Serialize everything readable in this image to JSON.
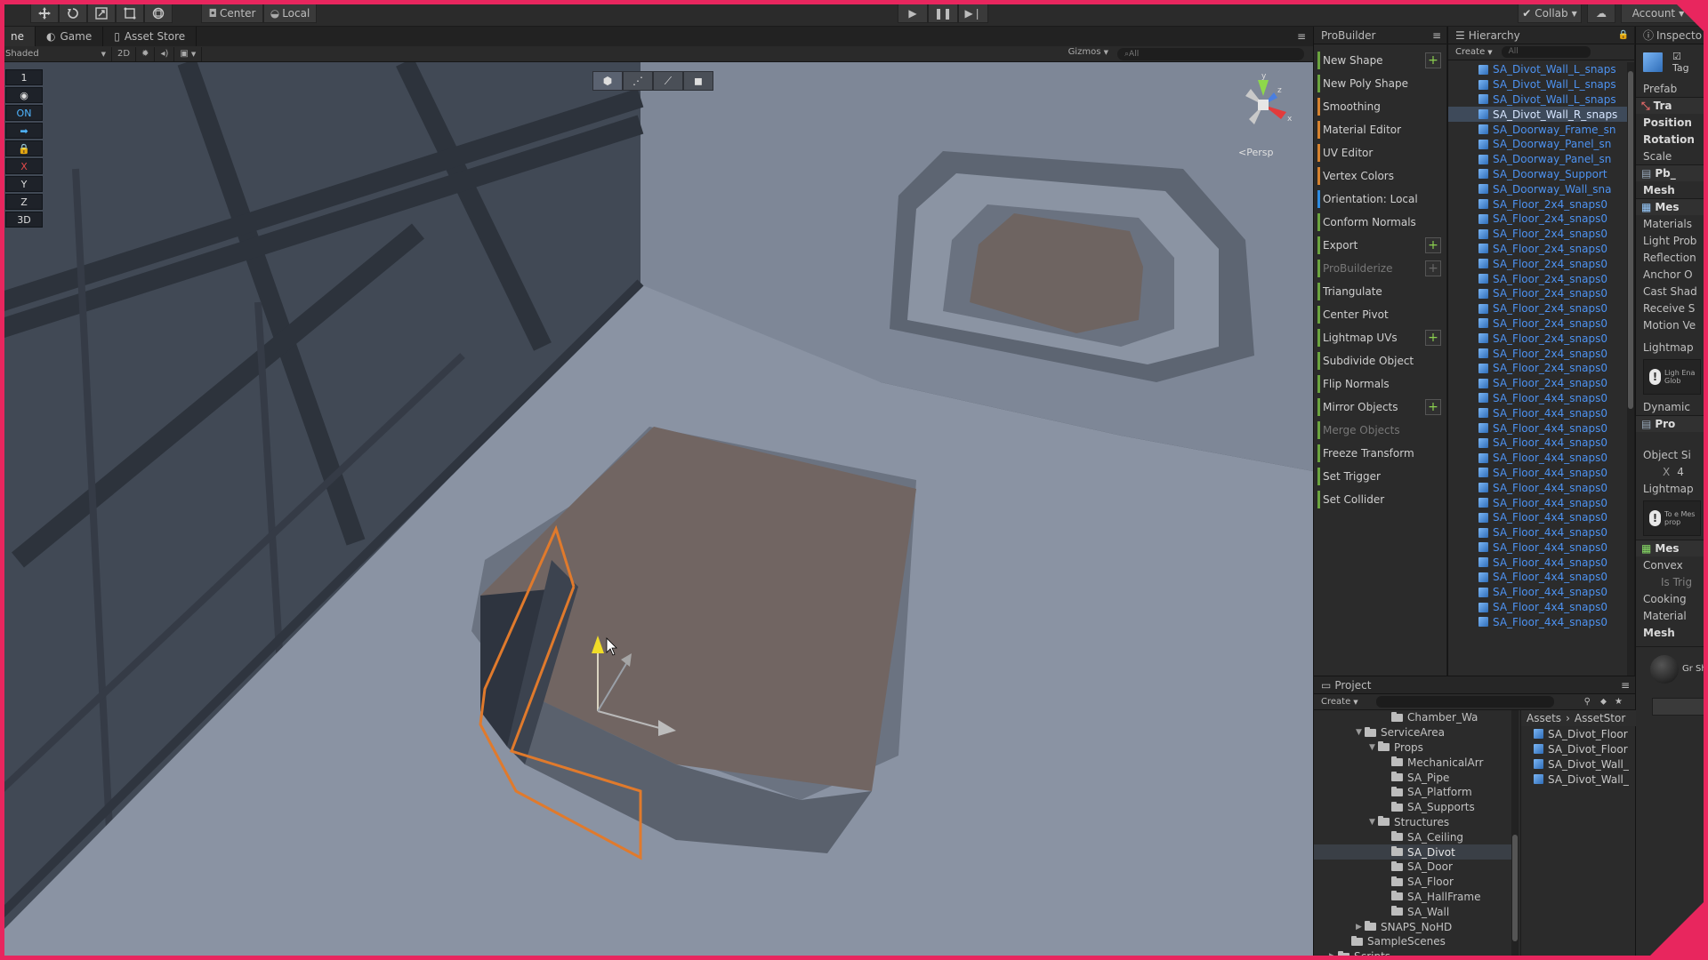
{
  "toolbar": {
    "pivot_mode": "Center",
    "pivot_rotation": "Local",
    "collab": "Collab",
    "account": "Account"
  },
  "scene_tabs": [
    {
      "label": "ne",
      "icon": "scene-icon"
    },
    {
      "label": "Game",
      "icon": "game-icon"
    },
    {
      "label": "Asset Store",
      "icon": "store-icon"
    }
  ],
  "scene_controls": {
    "draw_mode": "Shaded",
    "mode_2d": "2D",
    "gizmos": "Gizmos",
    "search_placeholder": "All"
  },
  "left_overlay": {
    "items": [
      "1",
      "",
      "ON",
      "",
      "",
      "X",
      "Y",
      "Z",
      "3D"
    ]
  },
  "scene": {
    "persp_label": "Persp",
    "axis_y": "y",
    "axis_x": "x",
    "axis_z": "z"
  },
  "probuilder": {
    "title": "ProBuilder",
    "items": [
      {
        "label": "New Shape",
        "color": "green",
        "plus": true,
        "enabled": true
      },
      {
        "label": "New Poly Shape",
        "color": "green",
        "plus": false,
        "enabled": true
      },
      {
        "label": "Smoothing",
        "color": "orange",
        "plus": false,
        "enabled": true
      },
      {
        "label": "Material Editor",
        "color": "orange",
        "plus": false,
        "enabled": true
      },
      {
        "label": "UV Editor",
        "color": "orange",
        "plus": false,
        "enabled": true
      },
      {
        "label": "Vertex Colors",
        "color": "orange",
        "plus": false,
        "enabled": true
      },
      {
        "label": "Orientation: Local",
        "color": "blue",
        "plus": false,
        "enabled": true
      },
      {
        "label": "Conform Normals",
        "color": "green",
        "plus": false,
        "enabled": true
      },
      {
        "label": "Export",
        "color": "green",
        "plus": true,
        "enabled": true
      },
      {
        "label": "ProBuilderize",
        "color": "green",
        "plus": true,
        "enabled": false
      },
      {
        "label": "Triangulate",
        "color": "green",
        "plus": false,
        "enabled": true
      },
      {
        "label": "Center Pivot",
        "color": "green",
        "plus": false,
        "enabled": true
      },
      {
        "label": "Lightmap UVs",
        "color": "green",
        "plus": true,
        "enabled": true
      },
      {
        "label": "Subdivide Object",
        "color": "green",
        "plus": false,
        "enabled": true
      },
      {
        "label": "Flip Normals",
        "color": "green",
        "plus": false,
        "enabled": true
      },
      {
        "label": "Mirror Objects",
        "color": "green",
        "plus": true,
        "enabled": true
      },
      {
        "label": "Merge Objects",
        "color": "green",
        "plus": false,
        "enabled": false
      },
      {
        "label": "Freeze Transform",
        "color": "green",
        "plus": false,
        "enabled": true
      },
      {
        "label": "Set Trigger",
        "color": "green",
        "plus": false,
        "enabled": true
      },
      {
        "label": "Set Collider",
        "color": "green",
        "plus": false,
        "enabled": true
      }
    ]
  },
  "hierarchy": {
    "title": "Hierarchy",
    "create": "Create",
    "search_placeholder": "All",
    "items": [
      "SA_Divot_Wall_L_snaps",
      "SA_Divot_Wall_L_snaps",
      "SA_Divot_Wall_L_snaps",
      "SA_Divot_Wall_R_snaps",
      "SA_Doorway_Frame_sn",
      "SA_Doorway_Panel_sn",
      "SA_Doorway_Panel_sn",
      "SA_Doorway_Support",
      "SA_Doorway_Wall_sna",
      "SA_Floor_2x4_snaps0",
      "SA_Floor_2x4_snaps0",
      "SA_Floor_2x4_snaps0",
      "SA_Floor_2x4_snaps0",
      "SA_Floor_2x4_snaps0",
      "SA_Floor_2x4_snaps0",
      "SA_Floor_2x4_snaps0",
      "SA_Floor_2x4_snaps0",
      "SA_Floor_2x4_snaps0",
      "SA_Floor_2x4_snaps0",
      "SA_Floor_2x4_snaps0",
      "SA_Floor_2x4_snaps0",
      "SA_Floor_2x4_snaps0",
      "SA_Floor_4x4_snaps0",
      "SA_Floor_4x4_snaps0",
      "SA_Floor_4x4_snaps0",
      "SA_Floor_4x4_snaps0",
      "SA_Floor_4x4_snaps0",
      "SA_Floor_4x4_snaps0",
      "SA_Floor_4x4_snaps0",
      "SA_Floor_4x4_snaps0",
      "SA_Floor_4x4_snaps0",
      "SA_Floor_4x4_snaps0",
      "SA_Floor_4x4_snaps0",
      "SA_Floor_4x4_snaps0",
      "SA_Floor_4x4_snaps0",
      "SA_Floor_4x4_snaps0",
      "SA_Floor_4x4_snaps0",
      "SA_Floor_4x4_snaps0"
    ],
    "selected_index": 3
  },
  "inspector": {
    "title": "Inspecto",
    "tag_label": "Tag",
    "prefab_label": "Prefab",
    "transform_header": "Tra",
    "position": "Position",
    "rotation": "Rotation",
    "scale": "Scale",
    "pb_header": "Pb_",
    "mesh_label": "Mesh",
    "mesh_renderer_header": "Mes",
    "materials": "Materials",
    "light_probes": "Light Prob",
    "reflection": "Reflection",
    "anchor": "Anchor O",
    "cast_shadows": "Cast Shad",
    "receive_shadows": "Receive S",
    "motion_vectors": "Motion Ve",
    "lightmap": "Lightmap",
    "lightmap_note": "Ligh Ena Glob",
    "dynamic": "Dynamic",
    "pro_header": "Pro",
    "object_size": "Object Si",
    "size_x_label": "X",
    "size_x_value": "4",
    "lightmap2": "Lightmap",
    "lightmap_note2": "To e Mes prop",
    "mesh_collider_header": "Mes",
    "convex": "Convex",
    "is_trigger": "Is Trig",
    "cooking": "Cooking",
    "material": "Material",
    "mesh2": "Mesh",
    "material_preview_label": "Gr Sh"
  },
  "project": {
    "title": "Project",
    "create": "Create",
    "tree": [
      {
        "label": "Chamber_Wa",
        "indent": 5,
        "arrow": "",
        "selected": false
      },
      {
        "label": "ServiceArea",
        "indent": 3,
        "arrow": "▼",
        "selected": false
      },
      {
        "label": "Props",
        "indent": 4,
        "arrow": "▼",
        "selected": false
      },
      {
        "label": "MechanicalArr",
        "indent": 5,
        "arrow": "",
        "selected": false
      },
      {
        "label": "SA_Pipe",
        "indent": 5,
        "arrow": "",
        "selected": false
      },
      {
        "label": "SA_Platform",
        "indent": 5,
        "arrow": "",
        "selected": false
      },
      {
        "label": "SA_Supports",
        "indent": 5,
        "arrow": "",
        "selected": false
      },
      {
        "label": "Structures",
        "indent": 4,
        "arrow": "▼",
        "selected": false
      },
      {
        "label": "SA_Ceiling",
        "indent": 5,
        "arrow": "",
        "selected": false
      },
      {
        "label": "SA_Divot",
        "indent": 5,
        "arrow": "",
        "selected": true
      },
      {
        "label": "SA_Door",
        "indent": 5,
        "arrow": "",
        "selected": false
      },
      {
        "label": "SA_Floor",
        "indent": 5,
        "arrow": "",
        "selected": false
      },
      {
        "label": "SA_HallFrame",
        "indent": 5,
        "arrow": "",
        "selected": false
      },
      {
        "label": "SA_Wall",
        "indent": 5,
        "arrow": "",
        "selected": false
      },
      {
        "label": "SNAPS_NoHD",
        "indent": 3,
        "arrow": "▶",
        "selected": false
      },
      {
        "label": "SampleScenes",
        "indent": 2,
        "arrow": "",
        "selected": false
      },
      {
        "label": "Scripts",
        "indent": 1,
        "arrow": "▶",
        "selected": false
      }
    ],
    "breadcrumb": [
      "Assets",
      "AssetStor"
    ],
    "assets": [
      "SA_Divot_Floor",
      "SA_Divot_Floor",
      "SA_Divot_Wall_",
      "SA_Divot_Wall_"
    ]
  },
  "colors": {
    "accent_frame": "#e8265e",
    "selection_orange": "#e07a2c",
    "hierarchy_blue": "#4d92f0"
  }
}
